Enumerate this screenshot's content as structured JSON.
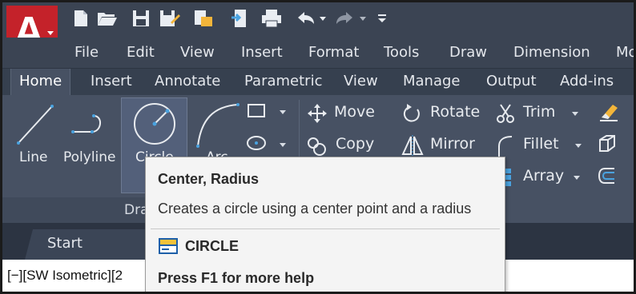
{
  "app": {
    "logo_letter": "A",
    "brand_color": "#c4222a"
  },
  "quick_access": [
    {
      "name": "new-icon"
    },
    {
      "name": "open-icon"
    },
    {
      "name": "save-icon"
    },
    {
      "name": "save-as-icon"
    },
    {
      "name": "open-web-icon"
    },
    {
      "name": "share-icon"
    },
    {
      "name": "plot-icon"
    },
    {
      "name": "undo-icon"
    },
    {
      "name": "redo-icon"
    },
    {
      "name": "customize-icon"
    }
  ],
  "menu": [
    "File",
    "Edit",
    "View",
    "Insert",
    "Format",
    "Tools",
    "Draw",
    "Dimension",
    "Mo"
  ],
  "tabs": [
    "Home",
    "Insert",
    "Annotate",
    "Parametric",
    "View",
    "Manage",
    "Output",
    "Add-ins"
  ],
  "active_tab": "Home",
  "draw_panel": {
    "tools": [
      "Line",
      "Polyline",
      "Circle",
      "Arc"
    ],
    "footer_label": "Dra"
  },
  "modify_panel": {
    "move": "Move",
    "rotate": "Rotate",
    "trim": "Trim",
    "copy": "Copy",
    "mirror": "Mirror",
    "fillet": "Fillet",
    "array": "Array"
  },
  "file_tab": {
    "label": "Start"
  },
  "viewport": {
    "controls": "[−][SW Isometric][2"
  },
  "tooltip": {
    "title": "Center, Radius",
    "description": "Creates a circle using a center point and a radius",
    "command": "CIRCLE",
    "help": "Press F1 for more help"
  },
  "colors": {
    "title_bar": "#3b4453",
    "ribbon": "#475163",
    "tooltip_bg": "#f4f4f4"
  }
}
